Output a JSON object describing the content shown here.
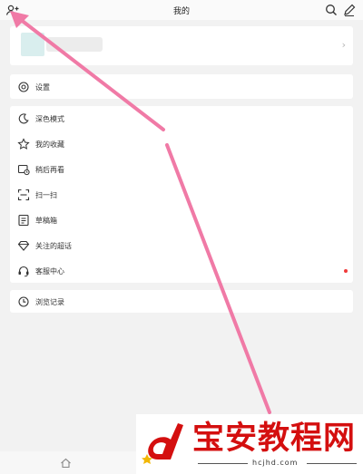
{
  "header": {
    "title": "我的"
  },
  "profile": {
    "chevron": "›"
  },
  "settings": {
    "label": "设置"
  },
  "menu": {
    "items": [
      {
        "label": "深色模式",
        "icon": "moon-icon"
      },
      {
        "label": "我的收藏",
        "icon": "star-icon"
      },
      {
        "label": "稍后再看",
        "icon": "watch-later-icon"
      },
      {
        "label": "扫一扫",
        "icon": "scan-icon"
      },
      {
        "label": "草稿箱",
        "icon": "draft-icon"
      },
      {
        "label": "关注的超话",
        "icon": "diamond-icon"
      },
      {
        "label": "客服中心",
        "icon": "headset-icon"
      }
    ]
  },
  "history": {
    "label": "浏览记录"
  },
  "watermark": {
    "title": "宝安教程网",
    "url": "hcjhd.com"
  },
  "colors": {
    "arrow": "#f07aa6",
    "badge": "#f03a3a",
    "watermark": "#d40f0f"
  }
}
